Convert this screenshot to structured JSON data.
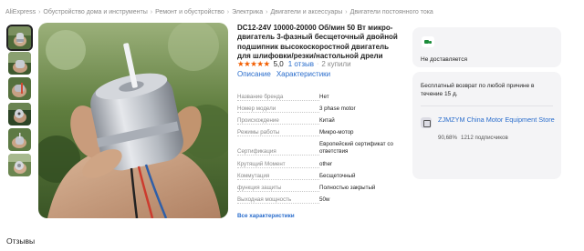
{
  "breadcrumb": [
    "AliExpress",
    "Обустройство дома и инструменты",
    "Ремонт и обустройство",
    "Электрика",
    "Двигатели и аксессуары",
    "Двигатели постоянного тока"
  ],
  "breadcrumb_separator": "›",
  "product": {
    "title": "DC12-24V 10000-20000 Об/мин 50 Вт микро-двигатель 3-фазный бесщеточный двойной подшипник высокоскоростной двигатель для шлифовки/резки/настольной дрели",
    "rating_stars": "★★★★★",
    "rating_score": "5,0",
    "reviews_count": "1 отзыв",
    "bought_count": "2 купили",
    "dot": "·"
  },
  "tabs": [
    "Описание",
    "Характеристики"
  ],
  "specs": [
    {
      "key": "Название бренда",
      "value": "Нет"
    },
    {
      "key": "Номер модели",
      "value": "3 phase motor"
    },
    {
      "key": "Происхождение",
      "value": "Китай"
    },
    {
      "key": "Режимы работы",
      "value": "Микро-мотор"
    },
    {
      "key": "Сертификация",
      "value": "Европейский сертификат со ответствия"
    },
    {
      "key": "Крутящий Момент",
      "value": "other"
    },
    {
      "key": "Коммутация",
      "value": "Бесщеточный"
    },
    {
      "key": "функция защиты",
      "value": "Полностью закрытый"
    },
    {
      "key": "Выходная мощность",
      "value": "50w"
    }
  ],
  "all_specs_link": "Все характеристики",
  "delivery": {
    "status": "Не доставляется",
    "icon": "truck-icon",
    "icon_color": "#1c8c3a"
  },
  "returns": "Бесплатный возврат по любой причине в течение 15 д.",
  "store": {
    "name": "ZJMZYM China Motor Equipment Store",
    "positive": "90,68%",
    "followers": "1212 подписчиков",
    "icon": "store-icon"
  },
  "reviews_heading": "Отзывы",
  "colors": {
    "link": "#2a6dcc",
    "star": "#f25d00",
    "card_bg": "#f4f4f6"
  }
}
